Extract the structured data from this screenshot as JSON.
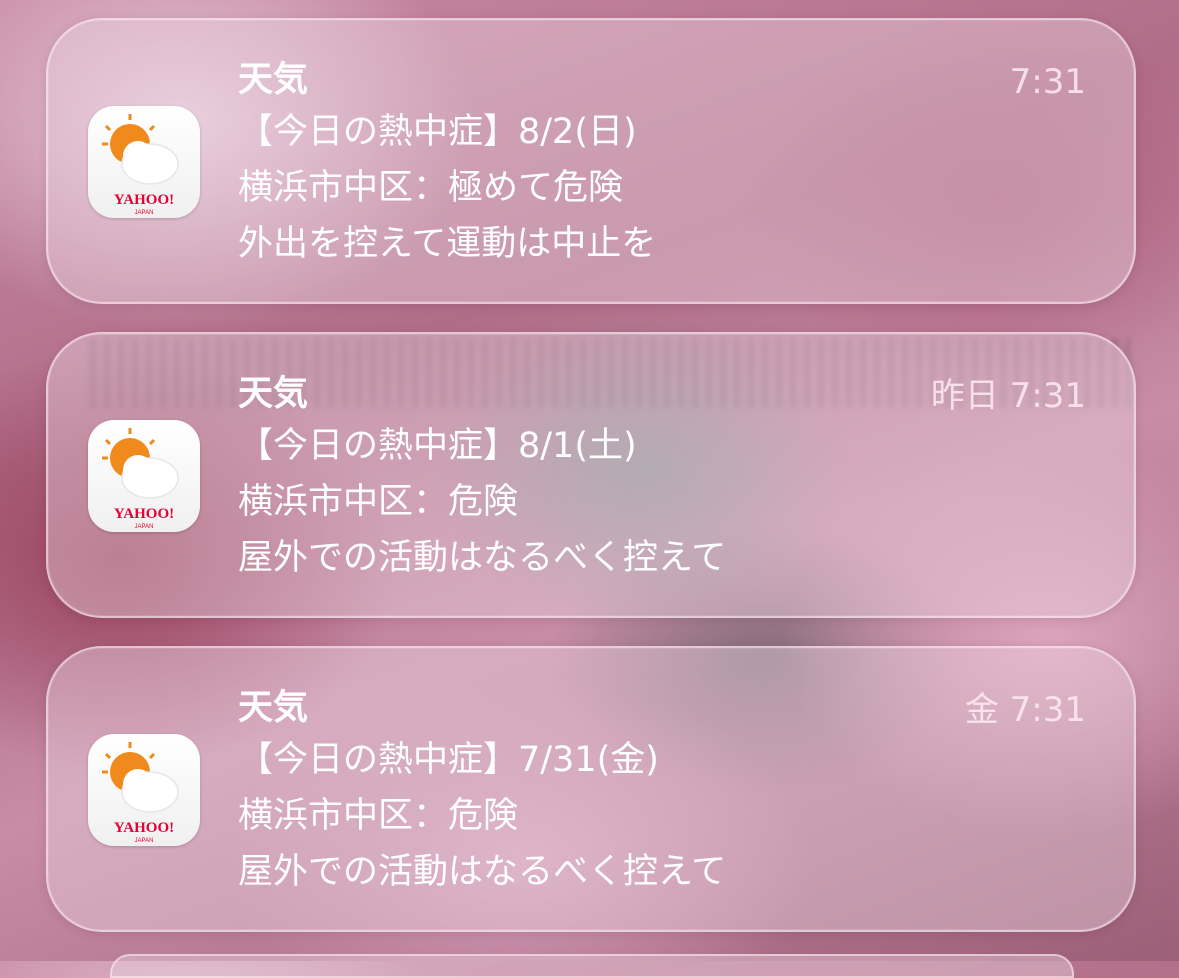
{
  "notifications": [
    {
      "app_name": "天気",
      "time": "7:31",
      "line1": "【今日の熱中症】8/2(日)",
      "line2": "横浜市中区：極めて危険",
      "line3": "外出を控えて運動は中止を",
      "icon": "yahoo-weather-icon"
    },
    {
      "app_name": "天気",
      "time": "昨日 7:31",
      "line1": "【今日の熱中症】8/1(土)",
      "line2": "横浜市中区：危険",
      "line3": "屋外での活動はなるべく控えて",
      "icon": "yahoo-weather-icon"
    },
    {
      "app_name": "天気",
      "time": "金 7:31",
      "line1": "【今日の熱中症】7/31(金)",
      "line2": "横浜市中区：危険",
      "line3": "屋外での活動はなるべく控えて",
      "icon": "yahoo-weather-icon"
    }
  ],
  "icon_text": {
    "brand": "YAHOO!",
    "sub": "JAPAN"
  },
  "colors": {
    "sun": "#f08a1c",
    "brand_red": "#e60033"
  }
}
